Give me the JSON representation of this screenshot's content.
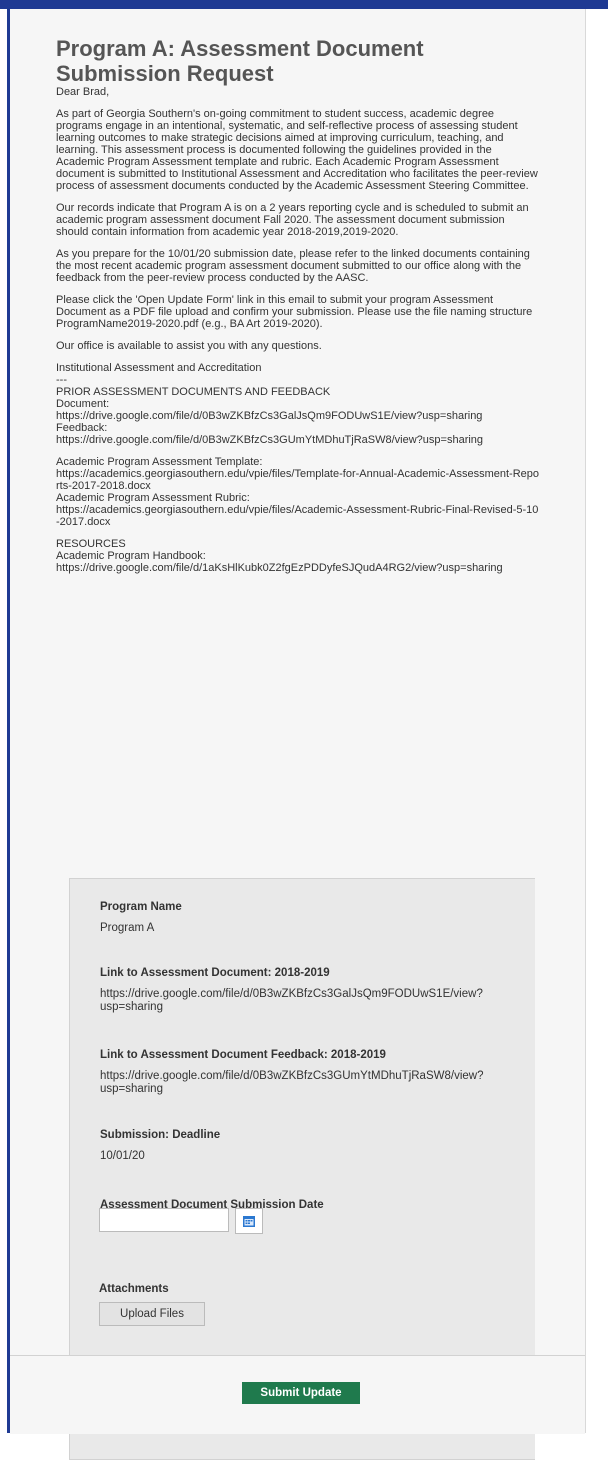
{
  "email": {
    "title": "Program A: Assessment Document Submission Request",
    "greeting": "Dear Brad,",
    "paragraphs": [
      "As part of Georgia Southern's on-going commitment to student success, academic degree programs engage in an intentional, systematic, and self-reflective process of assessing student learning outcomes to make strategic decisions aimed at improving curriculum, teaching, and learning. This assessment process is documented following the guidelines provided in the Academic Program Assessment template and rubric. Each Academic Program Assessment document is submitted to Institutional Assessment and Accreditation who facilitates the peer-review process of assessment documents conducted by the Academic Assessment Steering Committee.",
      "Our records indicate that Program A is on a 2 years reporting cycle and is scheduled to submit an academic program assessment document Fall 2020. The assessment document submission should contain information from academic year 2018-2019,2019-2020.",
      "As you prepare for the 10/01/20 submission date, please refer to the linked documents containing the most recent academic program assessment document submitted to our office along with the feedback from the peer-review process conducted by the AASC.",
      "Please click the 'Open Update Form' link in this email to submit your program Assessment Document as a PDF file upload and confirm your submission. Please use the file naming structure ProgramName2019-2020.pdf (e.g., BA Art 2019-2020).",
      "Our office is available to assist you with any questions."
    ],
    "signature": "Institutional Assessment and Accreditation",
    "separator": "---",
    "prior_heading": "PRIOR ASSESSMENT DOCUMENTS AND FEEDBACK",
    "document_label": "Document:",
    "document_url": "https://drive.google.com/file/d/0B3wZKBfzCs3GalJsQm9FODUwS1E/view?usp=sharing",
    "feedback_label": "Feedback:",
    "feedback_url": "https://drive.google.com/file/d/0B3wZKBfzCs3GUmYtMDhuTjRaSW8/view?usp=sharing",
    "template_label": "Academic Program Assessment Template:",
    "template_url": "https://academics.georgiasouthern.edu/vpie/files/Template-for-Annual-Academic-Assessment-Reports-2017-2018.docx",
    "rubric_label": "Academic Program Assessment Rubric:",
    "rubric_url": "https://academics.georgiasouthern.edu/vpie/files/Academic-Assessment-Rubric-Final-Revised-5-10-2017.docx",
    "resources_heading": "RESOURCES",
    "handbook_label": "Academic Program Handbook:",
    "handbook_url": "https://drive.google.com/file/d/1aKsHlKubk0Z2fgEzPDDyfeSJQudA4RG2/view?usp=sharing"
  },
  "form": {
    "program_name_label": "Program Name",
    "program_name_value": "Program A",
    "doc_link_label": "Link to Assessment Document: 2018-2019",
    "doc_link_line1": "https://drive.google.com/file/d/0B3wZKBfzCs3GalJsQm9FODUwS1E/view?",
    "doc_link_line2": "usp=sharing",
    "feedback_link_label": "Link to Assessment Document Feedback: 2018-2019",
    "feedback_link_line1": "https://drive.google.com/file/d/0B3wZKBfzCs3GUmYtMDhuTjRaSW8/view?",
    "feedback_link_line2": "usp=sharing",
    "deadline_label": "Submission: Deadline",
    "deadline_value": "10/01/20",
    "submission_date_label": "Assessment Document Submission Date",
    "submission_date_value": "",
    "attachments_label": "Attachments",
    "upload_button": "Upload Files",
    "calendar_icon": "calendar-icon"
  },
  "footer": {
    "submit_button": "Submit Update"
  },
  "colors": {
    "accent_blue": "#1f3a93",
    "submit_green": "#1f7a4d",
    "calendar_blue": "#2b78d0"
  }
}
